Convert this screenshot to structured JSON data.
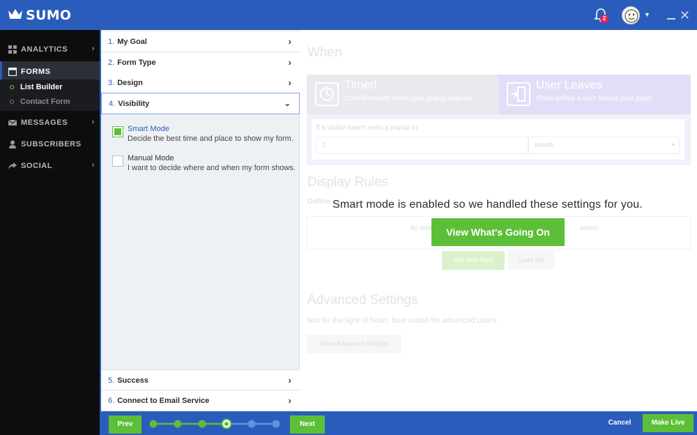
{
  "app": {
    "brand": "SUMO",
    "notification_count": "2"
  },
  "colors": {
    "accent_blue": "#2a5cbc",
    "green": "#5cbf37",
    "sidebar_bg": "#0d0d0d"
  },
  "sidebar": {
    "items": [
      {
        "label": "ANALYTICS",
        "icon": "grid-icon"
      },
      {
        "label": "FORMS",
        "icon": "form-icon"
      },
      {
        "label": "MESSAGES",
        "icon": "envelope-icon"
      },
      {
        "label": "SUBSCRIBERS",
        "icon": "person-icon"
      },
      {
        "label": "SOCIAL",
        "icon": "share-icon"
      }
    ],
    "sub_items": [
      {
        "label": "List Builder"
      },
      {
        "label": "Contact Form"
      }
    ]
  },
  "steps": [
    {
      "num": "1.",
      "label": "My Goal"
    },
    {
      "num": "2.",
      "label": "Form Type"
    },
    {
      "num": "3.",
      "label": "Design"
    },
    {
      "num": "4.",
      "label": "Visibility"
    },
    {
      "num": "5.",
      "label": "Success"
    },
    {
      "num": "6.",
      "label": "Connect to Email Service"
    }
  ],
  "visibility": {
    "smart_title": "Smart Mode",
    "smart_desc": "Decide the best time and place to show my form.",
    "smart_checked": true,
    "manual_title": "Manual Mode",
    "manual_desc": "I want to decide where and when my form shows.",
    "manual_checked": false
  },
  "main": {
    "when_heading": "When",
    "timed_title": "Timed",
    "timed_desc": "Control exactly when your popup appears.",
    "leaves_title": "User Leaves",
    "leaves_desc": "Show before a user leaves your page.",
    "visitor_label": "If a visitor hasn't seen a popup in",
    "visitor_value": "1",
    "period_value": "month",
    "display_heading": "Display Rules",
    "display_sub": "Define",
    "rules_text": "By defa",
    "rules_text_tail": "added.",
    "add_rule_label": "Add New Rule",
    "load_set_label": "Load set",
    "adv_heading": "Advanced Settings",
    "adv_sub": "Not for the light of heart, best suited for advanced users.",
    "adv_button": "Show Advanced Settings"
  },
  "overlay": {
    "message": "Smart mode is enabled so we handled these settings for you.",
    "button": "View What's Going On"
  },
  "footer": {
    "prev": "Prev",
    "next": "Next",
    "cancel": "Cancel",
    "make_live": "Make Live",
    "progress_current_step": 4,
    "progress_total_steps": 6
  }
}
